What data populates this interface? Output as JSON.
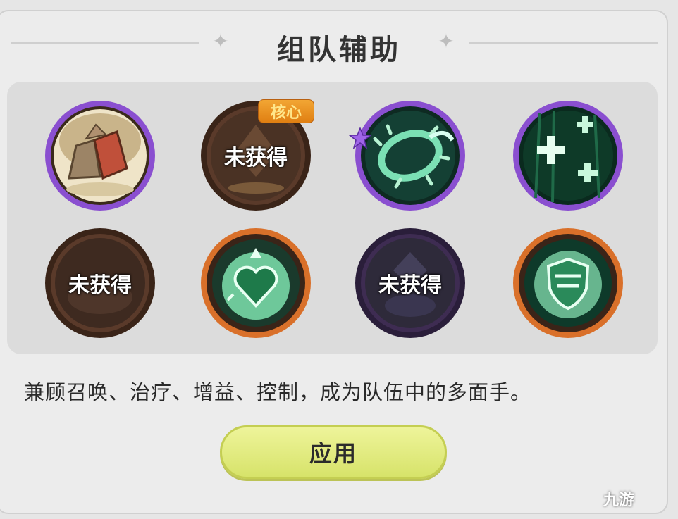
{
  "header": {
    "title": "组队辅助"
  },
  "skills": [
    {
      "id": "rocks",
      "ring": "#9a5fe0",
      "state": "owned"
    },
    {
      "id": "core-locked",
      "ring": "#5a3a2a",
      "state": "locked",
      "label": "未获得",
      "badge": "核心"
    },
    {
      "id": "thorn-ring",
      "ring": "#9a5fe0",
      "state": "owned"
    },
    {
      "id": "heal-plus",
      "ring": "#9a5fe0",
      "state": "owned"
    },
    {
      "id": "locked-brown",
      "ring": "#5a3a2a",
      "state": "locked",
      "label": "未获得"
    },
    {
      "id": "heart",
      "ring": "#e0802a",
      "state": "owned"
    },
    {
      "id": "locked-purple",
      "ring": "#3e2c52",
      "state": "locked",
      "label": "未获得"
    },
    {
      "id": "shield",
      "ring": "#e0802a",
      "state": "owned"
    }
  ],
  "description": "兼顾召唤、治疗、增益、控制，成为队伍中的多面手。",
  "apply_button": {
    "label": "应用"
  },
  "watermark": "九游",
  "colors": {
    "accent_button": "#e2eb7c",
    "core_badge": "#e8901e",
    "purple_ring": "#9a5fe0",
    "orange_ring": "#e0802a"
  }
}
